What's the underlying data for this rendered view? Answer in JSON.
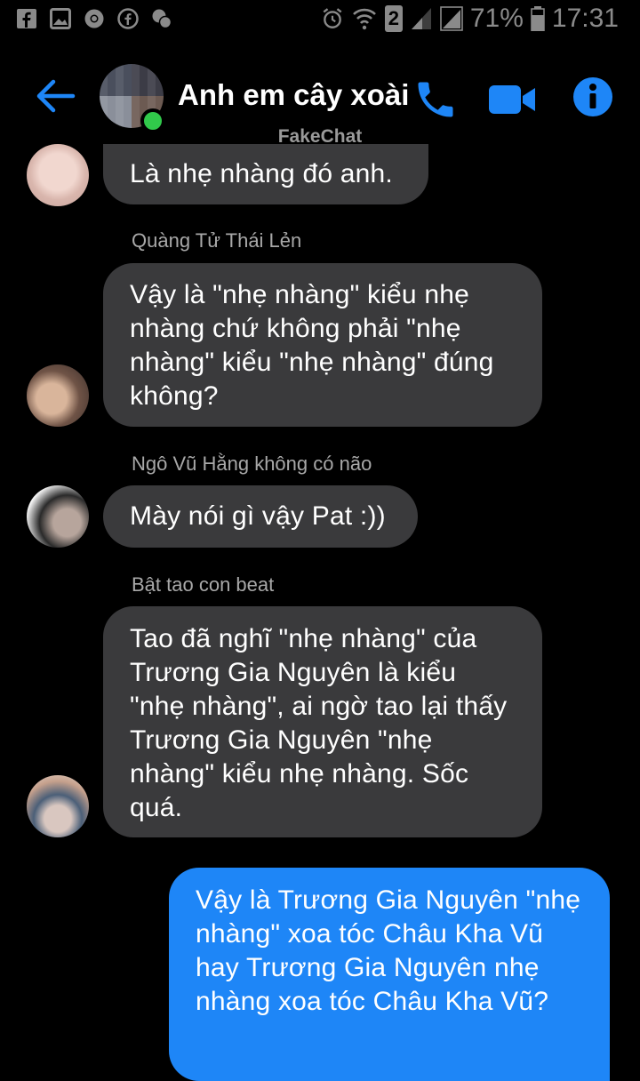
{
  "status_bar": {
    "battery": "71%",
    "time": "17:31",
    "sim": "2"
  },
  "header": {
    "title": "Anh em cây xoài",
    "watermark": "FakeChat",
    "icons": [
      "back-arrow-icon",
      "phone-icon",
      "video-camera-icon",
      "info-icon"
    ],
    "accent_color": "#1e86f7",
    "online_color": "#31c94b"
  },
  "messages": [
    {
      "text": "Là nhẹ nhàng đó anh."
    },
    {
      "sender": "Quàng Tử Thái Lẻn",
      "text": "Vậy là \"nhẹ nhàng\" kiểu nhẹ nhàng chứ không phải \"nhẹ nhàng\" kiểu \"nhẹ nhàng\" đúng không?"
    },
    {
      "sender": "Ngô Vũ Hằng không có não",
      "text": "Mày nói gì vậy Pat :))"
    },
    {
      "sender": "Bật tao con beat",
      "text": "Tao đã nghĩ \"nhẹ nhàng\" của Trương Gia Nguyên là kiểu \"nhẹ nhàng\", ai ngờ tao lại thấy Trương Gia Nguyên \"nhẹ nhàng\" kiểu nhẹ nhàng. Sốc quá."
    },
    {
      "text": "Vậy là Trương Gia Nguyên \"nhẹ nhàng\" xoa tóc Châu Kha Vũ hay Trương Gia Nguyên nhẹ nhàng xoa tóc Châu Kha Vũ?"
    }
  ]
}
